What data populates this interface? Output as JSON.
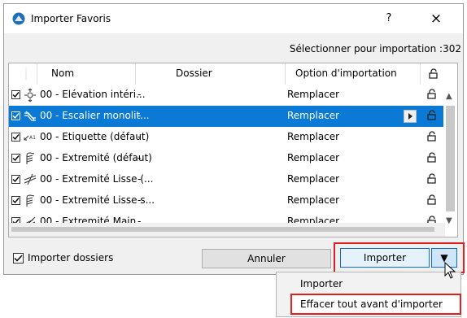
{
  "window": {
    "title": "Importer Favoris",
    "help_label": "?",
    "close_label": "×"
  },
  "selection_label": "Sélectionner pour importation :302",
  "columns": {
    "name": "Nom",
    "folder": "Dossier",
    "option": "Option d'importation"
  },
  "rows": [
    {
      "name": "00 - Elévation intéri...",
      "folder": "-",
      "option": "Remplacer",
      "icon": "elevation-icon",
      "selected": false
    },
    {
      "name": "00 - Escalier monolit...",
      "folder": "-",
      "option": "Remplacer",
      "icon": "stair-icon",
      "selected": true
    },
    {
      "name": "00 - Etiquette (défaut)",
      "folder": "-",
      "option": "Remplacer",
      "icon": "label-icon",
      "selected": false
    },
    {
      "name": "00 - Extremité (défaut)",
      "folder": "-",
      "option": "Remplacer",
      "icon": "railing-end-icon",
      "selected": false
    },
    {
      "name": "00 - Extremité Lisse (...",
      "folder": "-",
      "option": "Remplacer",
      "icon": "rail-end-icon",
      "selected": false
    },
    {
      "name": "00 - Extremité Lisse s...",
      "folder": "-",
      "option": "Remplacer",
      "icon": "railing-end-icon",
      "selected": false
    },
    {
      "name": "00 - Extremité Main ...",
      "folder": "-",
      "option": "Remplacer",
      "icon": "handrail-end-icon",
      "selected": false
    }
  ],
  "footer": {
    "import_folders_label": "Importer dossiers",
    "cancel_label": "Annuler",
    "import_label": "Importer",
    "import_arrow": "▼"
  },
  "dropdown": {
    "items": [
      "Importer",
      "Effacer tout avant d'importer"
    ]
  },
  "colors": {
    "selection": "#0a7ad6",
    "highlight": "#e02020"
  }
}
